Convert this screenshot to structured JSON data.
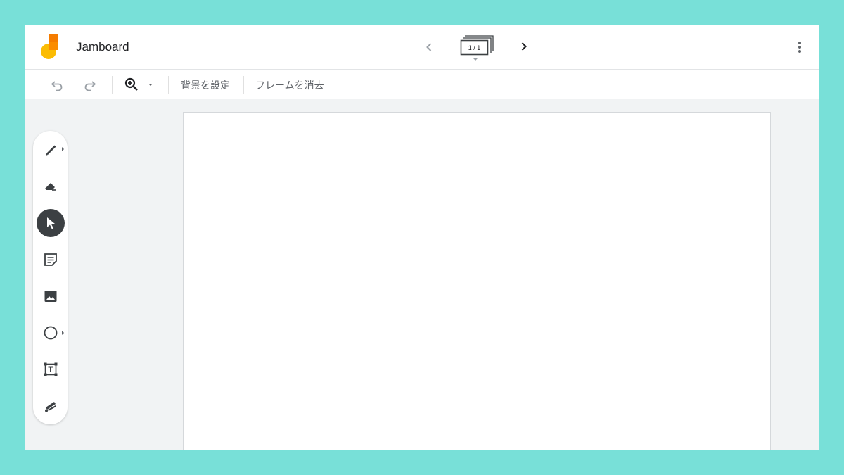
{
  "app": {
    "title": "Jamboard",
    "frame_indicator": "1 / 1"
  },
  "toolbar": {
    "undo_icon": "undo-icon",
    "redo_icon": "redo-icon",
    "zoom_icon": "zoom-in-icon",
    "set_background_label": "背景を設定",
    "clear_frame_label": "フレームを消去"
  },
  "tools": [
    {
      "name": "pen",
      "icon": "pen-icon"
    },
    {
      "name": "eraser",
      "icon": "eraser-icon"
    },
    {
      "name": "select",
      "icon": "pointer-icon",
      "active": true
    },
    {
      "name": "sticky-note",
      "icon": "sticky-note-icon"
    },
    {
      "name": "image",
      "icon": "image-icon"
    },
    {
      "name": "circle",
      "icon": "circle-icon"
    },
    {
      "name": "text-box",
      "icon": "text-box-icon"
    },
    {
      "name": "laser",
      "icon": "laser-icon"
    }
  ],
  "colors": {
    "outer_background": "#78e0d8",
    "app_background": "#f1f3f4",
    "active_tool": "#3c4043",
    "icon_gray": "#5f6368",
    "logo_yellow": "#fbbc04",
    "logo_orange": "#f57c00"
  }
}
